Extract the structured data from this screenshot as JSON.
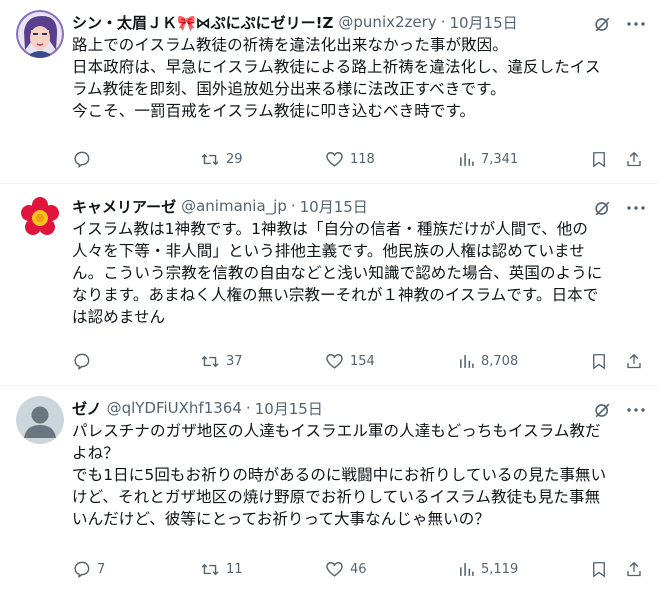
{
  "tweets": [
    {
      "name": "シン・太眉ＪＫ🎀⋈ぷにぷにゼリー!Z",
      "handle": "@punix2zery",
      "separator": "·",
      "time": "10月15日",
      "avatar_color": "#7b5ea7",
      "lines": [
        "路上でのイスラム教徒の祈祷を違法化出来なかった事が敗因。",
        "日本政府は、早急にイスラム教徒による路上祈祷を違法化し、違反したイス",
        "ラム教徒を即刻、国外追放処分出来る様に法改正すべきです。",
        "今こそ、一罰百戒をイスラム教徒に叩き込むべき時です。"
      ],
      "replies": "",
      "retweets": "29",
      "likes": "118",
      "views": "7,341"
    },
    {
      "name": "キャメリアーゼ",
      "handle": "@animania_jp",
      "separator": "·",
      "time": "10月15日",
      "avatar_color": "#e0143c",
      "lines": [
        "イスラム教は1神教です。1神教は「自分の信者・種族だけが人間で、他の",
        "人々を下等・非人間」という排他主義です。他民族の人権は認めていませ",
        "ん。こういう宗教を信教の自由などと浅い知識で認めた場合、英国のように",
        "なります。あまねく人権の無い宗教ーそれが１神教のイスラムです。日本で",
        "は認めません"
      ],
      "replies": "",
      "retweets": "37",
      "likes": "154",
      "views": "8,708"
    },
    {
      "name": "ゼノ",
      "handle": "@qlYDFiUXhf1364",
      "separator": "·",
      "time": "10月15日",
      "avatar_color": "#ccd6dd",
      "lines": [
        "パレスチナのガザ地区の人達もイスラエル軍の人達もどっちもイスラム教だ",
        "よね？",
        "でも1日に5回もお祈りの時があるのに戦闘中にお祈りしているの見た事無い",
        "けど、それとガザ地区の焼け野原でお祈りしているイスラム教徒も見た事無",
        "いんだけど、彼等にとってお祈りって大事なんじゃ無いの？"
      ],
      "replies": "7",
      "retweets": "11",
      "likes": "46",
      "views": "5,119"
    }
  ],
  "icons": {
    "grok": "grok-icon",
    "more": "more-icon",
    "reply": "reply-icon",
    "retweet": "retweet-icon",
    "like": "like-icon",
    "views": "views-icon",
    "bookmark": "bookmark-icon",
    "share": "share-icon"
  },
  "colors": {
    "text": "#0f1419",
    "secondary": "#536471",
    "border": "#eff3f4"
  }
}
